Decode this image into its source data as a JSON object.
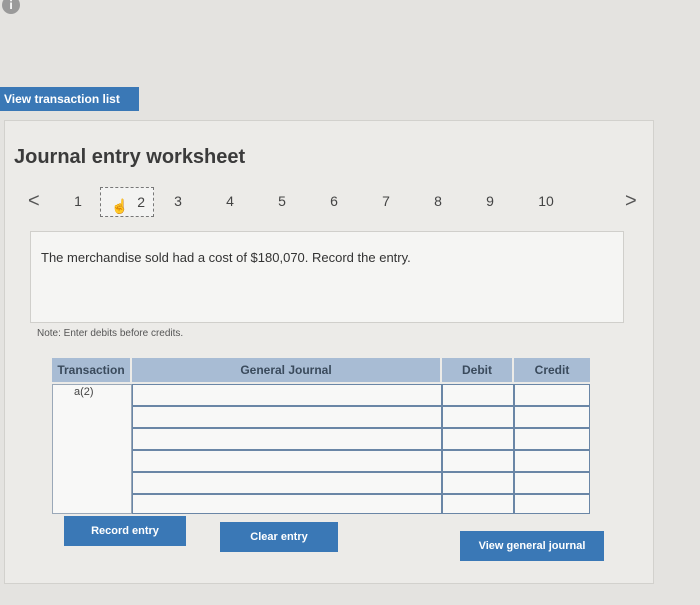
{
  "header": {
    "view_txn_label": "View transaction list"
  },
  "worksheet": {
    "title": "Journal entry worksheet"
  },
  "pager": {
    "prev": "<",
    "next": ">",
    "pages": [
      "1",
      "2",
      "3",
      "4",
      "5",
      "6",
      "7",
      "8",
      "9",
      "10"
    ],
    "active": "2"
  },
  "prompt": "The merchandise sold had a cost of $180,070. Record the entry.",
  "note": "Note: Enter debits before credits.",
  "table": {
    "headers": {
      "transaction": "Transaction",
      "journal": "General Journal",
      "debit": "Debit",
      "credit": "Credit"
    },
    "transaction_value": "a(2)"
  },
  "buttons": {
    "record": "Record entry",
    "clear": "Clear entry",
    "view_journal": "View general journal"
  },
  "colors": {
    "accent": "#3a78b6",
    "header_bg": "#a8bcd4"
  }
}
